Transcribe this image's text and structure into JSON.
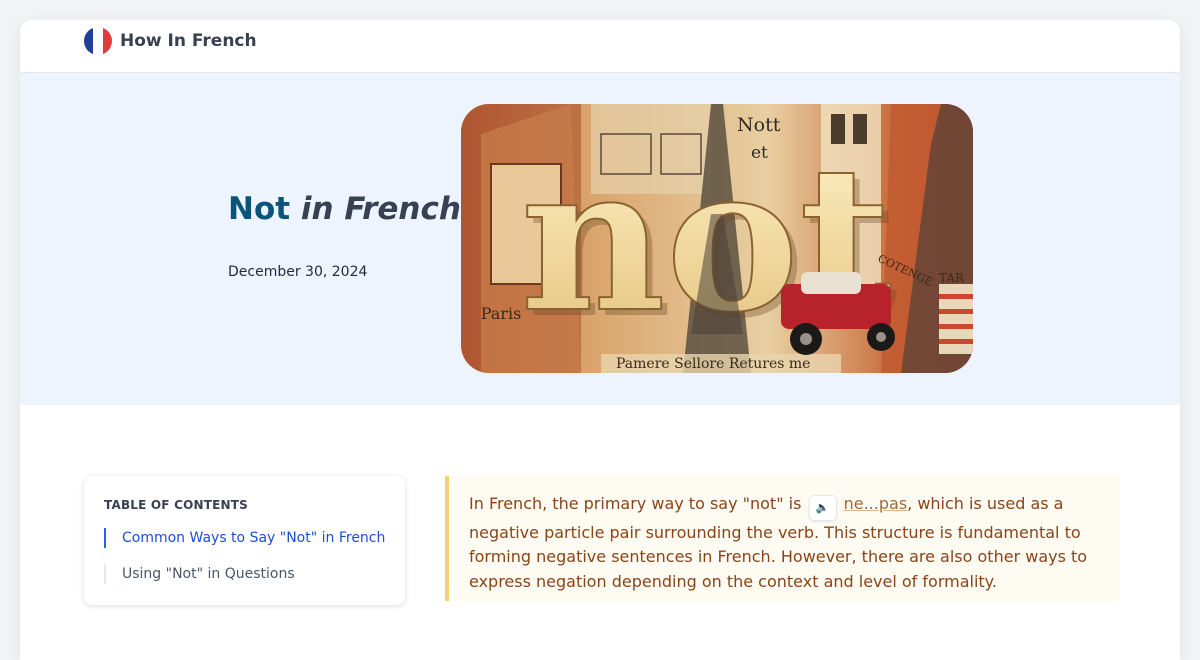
{
  "header": {
    "brand_name": "How In French",
    "flag_colors": [
      "#1f3f99",
      "#ffffff",
      "#e23a3f"
    ],
    "flag_icon": "france-flag-icon"
  },
  "hero": {
    "title_main": "Not",
    "title_rest": "in French",
    "date": "December 30, 2024",
    "image": {
      "big_word": "not",
      "overlay_texts": [
        "Nott",
        "et",
        "Paris",
        "Pamere Sellore Retures me",
        "COTENGE",
        "TAR"
      ]
    }
  },
  "toc": {
    "title": "TABLE OF CONTENTS",
    "items": [
      {
        "label": "Common Ways to Say \"Not\" in French",
        "active": true
      },
      {
        "label": "Using \"Not\" in Questions",
        "active": false
      }
    ]
  },
  "intro": {
    "before": "In French, the primary way to say \"not\" is ",
    "audio_icon": "speaker-icon",
    "audio_symbol": "🔈",
    "term": "ne...pas",
    "after": ", which is used as a negative particle pair surrounding the verb. This structure is fundamental to forming negative sentences in French. However, there are also other ways to express negation depending on the context and level of formality."
  },
  "colors": {
    "accent": "#0b5479",
    "toc_active": "#1d4ed8",
    "intro_text": "#8a4418",
    "intro_border": "#f3d46a"
  }
}
